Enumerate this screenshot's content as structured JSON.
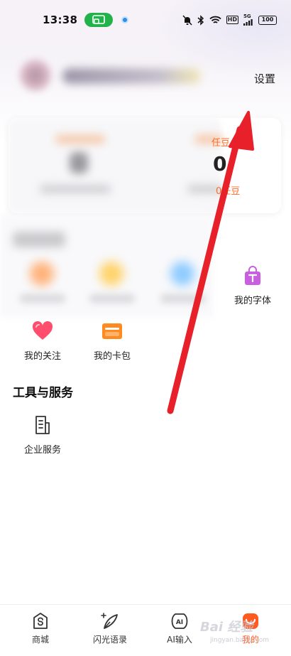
{
  "status_bar": {
    "time": "13:38",
    "battery": "100",
    "network_hd": "HD",
    "network_gen": "5G"
  },
  "header": {
    "settings_label": "设置"
  },
  "assets": {
    "label_fragment": "任豆",
    "value_fragment": "0",
    "sub_fragment": "0任豆"
  },
  "my_section": {
    "items": [
      {
        "label": "我的字体",
        "icon": "shopping-bag-t-icon",
        "color": "#c95fe0"
      },
      {
        "label": "我的关注",
        "icon": "heart-icon",
        "color": "#ff4d6d"
      },
      {
        "label": "我的卡包",
        "icon": "wallet-icon",
        "color": "#ff8a1f"
      }
    ]
  },
  "tools_section": {
    "title": "工具与服务",
    "items": [
      {
        "label": "企业服务",
        "icon": "document-icon"
      }
    ]
  },
  "tab_bar": {
    "tabs": [
      {
        "label": "商城",
        "icon": "shop-bag-icon"
      },
      {
        "label": "闪光语录",
        "icon": "feather-sparkle-icon"
      },
      {
        "label": "AI输入",
        "icon": "ai-input-icon"
      },
      {
        "label": "我的",
        "icon": "me-face-icon",
        "active": true
      }
    ]
  },
  "colors": {
    "accent": "#ff5a1f",
    "asset_orange": "#ff6a26",
    "annotation_red": "#e8202a"
  }
}
